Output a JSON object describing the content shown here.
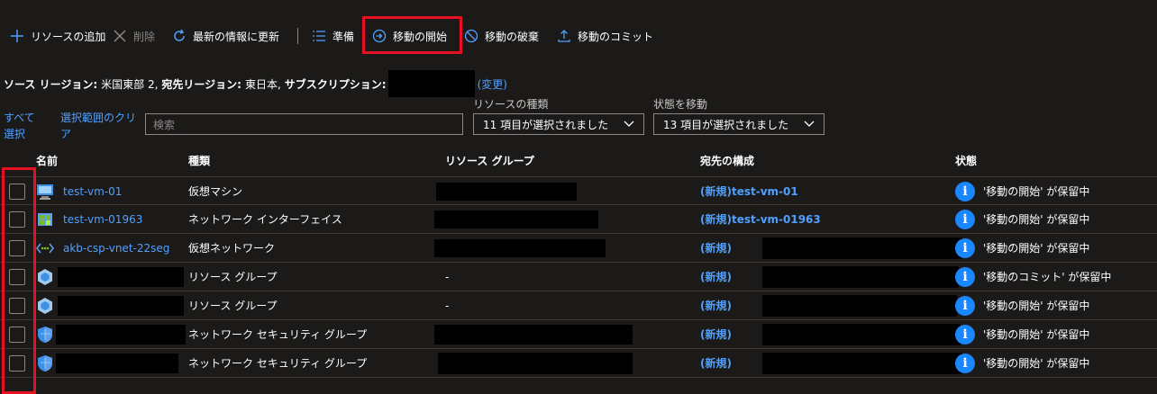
{
  "toolbar": {
    "add_label": "リソースの追加",
    "delete_label": "削除",
    "refresh_label": "最新の情報に更新",
    "prepare_label": "準備",
    "initiate_label": "移動の開始",
    "discard_label": "移動の破棄",
    "commit_label": "移動のコミット"
  },
  "info": {
    "source_region_label": "ソース リージョン:",
    "source_region_value": "米国東部 2,",
    "target_region_label": "宛先リージョン:",
    "target_region_value": "東日本,",
    "subscription_label": "サブスクリプション:",
    "change_link": "(変更)"
  },
  "filters": {
    "select_all": "すべて選択",
    "clear_selection": "選択範囲のクリア",
    "search_placeholder": "検索",
    "resource_type_label": "リソースの種類",
    "resource_type_value": "11 項目が選択されました",
    "move_state_label": "状態を移動",
    "move_state_value": "13 項目が選択されました"
  },
  "table": {
    "headers": {
      "name": "名前",
      "type": "種類",
      "resource_group": "リソース グループ",
      "destination": "宛先の構成",
      "state": "状態"
    },
    "rows": [
      {
        "icon": "virtual-machine-icon",
        "name": "test-vm-01",
        "type": "仮想マシン",
        "resource_group": "",
        "destination": "(新規)test-vm-01",
        "state": "'移動の開始' が保留中"
      },
      {
        "icon": "network-interface-icon",
        "name": "test-vm-01963",
        "type": "ネットワーク インターフェイス",
        "resource_group": "",
        "destination": "(新規)test-vm-01963",
        "state": "'移動の開始' が保留中"
      },
      {
        "icon": "virtual-network-icon",
        "name": "akb-csp-vnet-22seg",
        "type": "仮想ネットワーク",
        "resource_group": "",
        "destination": "(新規)",
        "state": "'移動の開始' が保留中"
      },
      {
        "icon": "resource-group-icon",
        "name": "",
        "type": "リソース グループ",
        "resource_group": "-",
        "destination": "(新規)",
        "state": "'移動のコミット' が保留中"
      },
      {
        "icon": "resource-group-icon",
        "name": "",
        "type": "リソース グループ",
        "resource_group": "-",
        "destination": "(新規)",
        "state": "'移動の開始' が保留中"
      },
      {
        "icon": "network-security-group-icon",
        "name": "",
        "type": "ネットワーク セキュリティ グループ",
        "resource_group": "",
        "destination": "(新規)",
        "state": "'移動の開始' が保留中"
      },
      {
        "icon": "network-security-group-icon",
        "name": "",
        "type": "ネットワーク セキュリティ グループ",
        "resource_group": "",
        "destination": "(新規)",
        "state": "'移動の開始' が保留中"
      }
    ]
  },
  "colors": {
    "background": "#1b1a19",
    "accent": "#4fa0ff",
    "highlight": "#e81123",
    "info": "#1a86ff"
  }
}
